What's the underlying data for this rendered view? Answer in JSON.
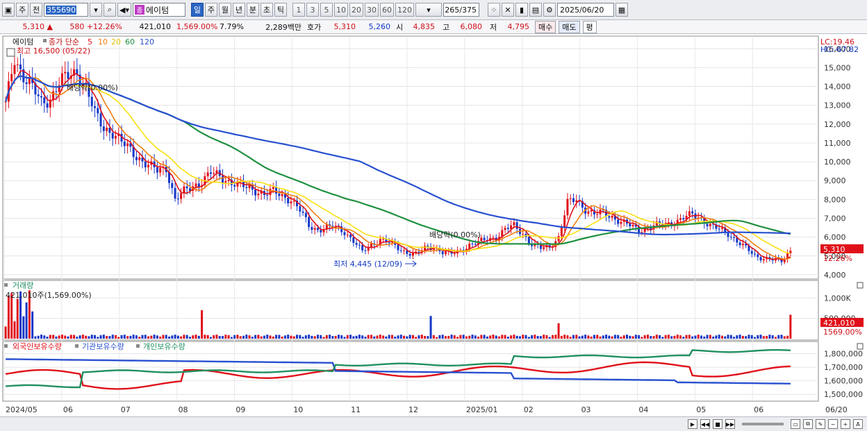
{
  "toolbar": {
    "period_label": "주",
    "prev_label": "전",
    "code": "355690",
    "stock_name": "에이텀",
    "stock_mark": "종",
    "periods": [
      "일",
      "주",
      "월",
      "년",
      "분",
      "초",
      "틱"
    ],
    "numbers": [
      "1",
      "3",
      "5",
      "10",
      "20",
      "30",
      "60",
      "120"
    ],
    "count_value": "265",
    "count_total": "/375",
    "date": "2025/06/20"
  },
  "quote": {
    "price": "5,310 ▲",
    "change": "580 +12.26%",
    "volume": "421,010",
    "volume_pct": "1,569.00%",
    "turnover_pct": "7.79%",
    "amount": "2,289백만",
    "hoga_label": "호가",
    "ask": "5,310",
    "bid": "5,260",
    "open_label": "시",
    "open": "4,835",
    "high_label": "고",
    "high": "6,080",
    "low_label": "저",
    "low": "4,795",
    "buy_label": "매수",
    "sell_label": "매도",
    "avg_label": "평"
  },
  "chart_data": [
    {
      "type": "candlestick",
      "legend_name": "에이텀",
      "legend_ma": "종가 단순",
      "ma_periods": [
        "5",
        "10",
        "20",
        "60",
        "120"
      ],
      "ma_colors": [
        "#e0101a",
        "#f08010",
        "#f8e010",
        "#209040",
        "#2850d0"
      ],
      "annotation_high": "최고 16,500 (05/22)",
      "annotation_low": "최저 4,445 (12/09)",
      "annotation_div1": "배당락(0.00%)",
      "annotation_div2": "배당락(0.00%)",
      "lc_label": "LC:19.46",
      "hc_label": "HC:-67.82",
      "last_price_label": "5,310",
      "last_change_label": "12.26%",
      "y_ticks": [
        "16,000",
        "15,000",
        "14,000",
        "13,000",
        "12,000",
        "11,000",
        "10,000",
        "9,000",
        "8,000",
        "7,000",
        "6,000",
        "5,000",
        "4,000"
      ],
      "y_values": [
        16000,
        15000,
        14000,
        13000,
        12000,
        11000,
        10000,
        9000,
        8000,
        7000,
        6000,
        5000,
        4000
      ],
      "ylim": [
        3850,
        16600
      ],
      "close_path": [
        13000,
        15500,
        14600,
        13900,
        13100,
        13400,
        14200,
        14500,
        14800,
        14000,
        12500,
        11800,
        11600,
        11000,
        10600,
        10200,
        9800,
        9500,
        9700,
        8000,
        8400,
        8700,
        9000,
        9400,
        9200,
        9000,
        8800,
        8600,
        8500,
        8300,
        8400,
        8200,
        8000,
        7400,
        6600,
        6400,
        6500,
        6500,
        6300,
        5800,
        5200,
        5600,
        5900,
        5700,
        5400,
        5200,
        5100,
        5400,
        5500,
        5200,
        5100,
        5300,
        5600,
        5700,
        5900,
        6000,
        6400,
        6600,
        6200,
        5600,
        5400,
        5500,
        6000,
        7800,
        8000,
        7500,
        7200,
        7300,
        7100,
        6800,
        6600,
        6400,
        6500,
        6600,
        6700,
        6800,
        7000,
        7200,
        7000,
        6600,
        6400,
        6200,
        5800,
        5400,
        5000,
        4900,
        4800,
        4700,
        5310
      ]
    },
    {
      "type": "bar",
      "legend_name": "거래량",
      "current_label": "421,010주(1,569.00%)",
      "y_ticks": [
        "1,000K",
        "500,000"
      ],
      "y_values": [
        1000000,
        500000
      ],
      "last_value_label": "421,010",
      "last_pct_label": "1569.00%",
      "ylim": [
        0,
        1400000
      ]
    },
    {
      "type": "line",
      "series": [
        {
          "name": "외국인보유수량",
          "color": "#e0101a"
        },
        {
          "name": "기관보유수량",
          "color": "#2850d0"
        },
        {
          "name": "개인보유수량",
          "color": "#209060"
        }
      ],
      "y_ticks": [
        "1,800,000",
        "1,700,000",
        "1,600,000",
        "1,500,000"
      ],
      "y_values": [
        1800000,
        1700000,
        1600000,
        1500000
      ],
      "ylim": [
        1460000,
        1880000
      ]
    }
  ],
  "x_ticks": [
    "2024/05",
    "06",
    "07",
    "08",
    "09",
    "10",
    "11",
    "12",
    "2025/01",
    "02",
    "03",
    "04",
    "05",
    "06",
    "06/20"
  ]
}
